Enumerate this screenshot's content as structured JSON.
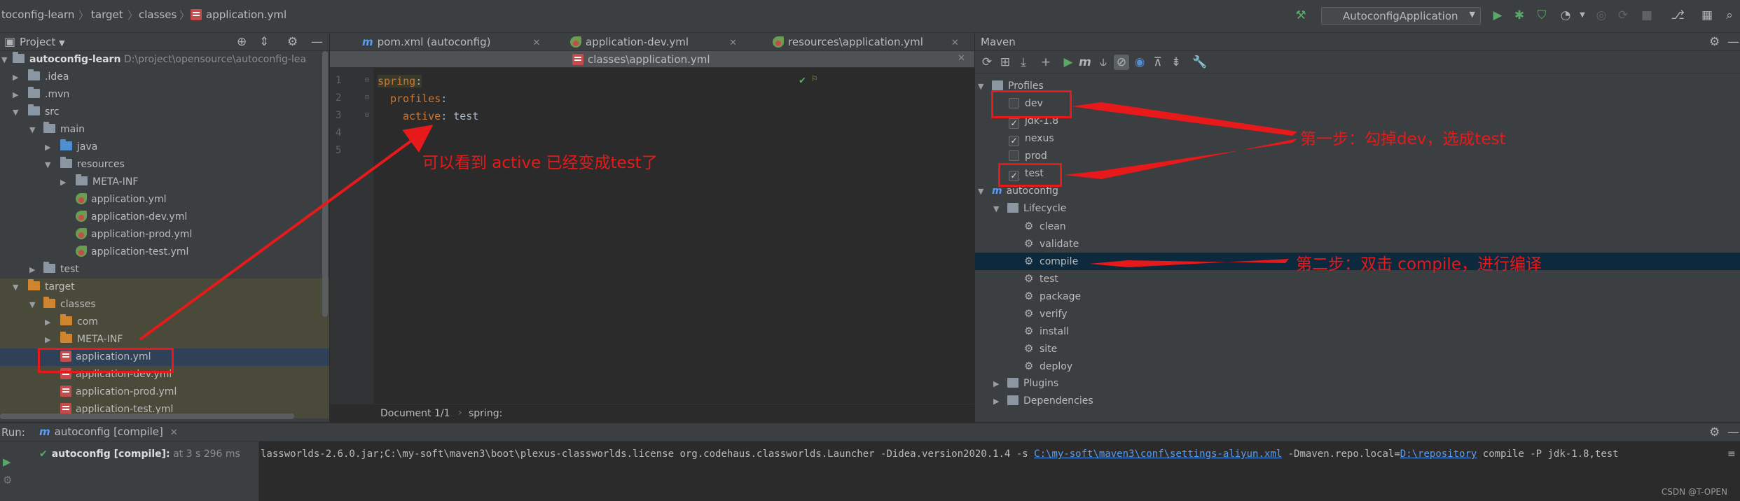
{
  "breadcrumb": [
    "toconfig-learn",
    "target",
    "classes",
    "application.yml"
  ],
  "toolbar": {
    "run_config": "AutoconfigApplication"
  },
  "project": {
    "title": "Project",
    "root_name": "autoconfig-learn",
    "root_path": "D:\\project\\opensource\\autoconfig-lea",
    "tree": [
      {
        "label": "autoconfig-learn",
        "depth": 0,
        "open": true
      },
      {
        "label": ".idea",
        "depth": 1,
        "open": false
      },
      {
        "label": ".mvn",
        "depth": 1,
        "open": false
      },
      {
        "label": "src",
        "depth": 1,
        "open": true
      },
      {
        "label": "main",
        "depth": 2,
        "open": true
      },
      {
        "label": "java",
        "depth": 3,
        "open": false
      },
      {
        "label": "resources",
        "depth": 3,
        "open": true
      },
      {
        "label": "META-INF",
        "depth": 4,
        "open": false
      },
      {
        "label": "application.yml",
        "depth": 5
      },
      {
        "label": "application-dev.yml",
        "depth": 5
      },
      {
        "label": "application-prod.yml",
        "depth": 5
      },
      {
        "label": "application-test.yml",
        "depth": 5
      },
      {
        "label": "test",
        "depth": 2,
        "open": false
      },
      {
        "label": "target",
        "depth": 1,
        "open": true
      },
      {
        "label": "classes",
        "depth": 2,
        "open": true
      },
      {
        "label": "com",
        "depth": 3,
        "open": false
      },
      {
        "label": "META-INF",
        "depth": 3,
        "open": false
      },
      {
        "label": "application.yml",
        "depth": 4,
        "selected": true
      },
      {
        "label": "application-dev.yml",
        "depth": 4
      },
      {
        "label": "application-prod.yml",
        "depth": 4
      },
      {
        "label": "application-test.yml",
        "depth": 4
      }
    ]
  },
  "editor": {
    "tabs": [
      {
        "label": "pom.xml (autoconfig)"
      },
      {
        "label": "application-dev.yml"
      },
      {
        "label": "resources\\application.yml"
      }
    ],
    "active_tab": "classes\\application.yml",
    "line_numbers": [
      "1",
      "2",
      "3",
      "4",
      "5"
    ],
    "lines": [
      {
        "key": "spring",
        "sep": ":",
        "value": ""
      },
      {
        "key": "profiles",
        "sep": ":",
        "value": ""
      },
      {
        "key": "active",
        "sep": ": ",
        "value": "test"
      }
    ],
    "status_doc": "Document 1/1",
    "status_path": "spring:"
  },
  "maven": {
    "title": "Maven",
    "profiles_label": "Profiles",
    "profiles": [
      {
        "name": "dev",
        "checked": false
      },
      {
        "name": "jdk-1.8",
        "checked": true
      },
      {
        "name": "nexus",
        "checked": true
      },
      {
        "name": "prod",
        "checked": false
      },
      {
        "name": "test",
        "checked": true
      }
    ],
    "project_label": "autoconfig",
    "lifecycle_label": "Lifecycle",
    "lifecycle": [
      "clean",
      "validate",
      "compile",
      "test",
      "package",
      "verify",
      "install",
      "site",
      "deploy"
    ],
    "selected_phase": "compile",
    "plugins_label": "Plugins",
    "dependencies_label": "Dependencies"
  },
  "run": {
    "label": "Run:",
    "tab": "autoconfig [compile]",
    "item_label": "autoconfig [compile]:",
    "item_time": "at 3 s 296 ms",
    "console_pre": "lassworlds-2.6.0.jar;C:\\my-soft\\maven3\\boot\\plexus-classworlds.license org.codehaus.classworlds.Launcher -Didea.version2020.1.4 -s ",
    "console_link1": "C:\\my-soft\\maven3\\conf\\settings-aliyun.xml",
    "console_mid": " -Dmaven.repo.local=",
    "console_link2": "D:\\repository",
    "console_post": " compile -P jdk-1.8,test"
  },
  "annotations": {
    "editor_note": "可以看到 active 已经变成test了",
    "step1": "第一步：勾掉dev，选成test",
    "step2": "第二步：双击 compile，进行编译",
    "watermark": "CSDN @T-OPEN"
  },
  "colors": {
    "annotation": "#e8191a",
    "keyword": "#cc7832",
    "link": "#589df6"
  }
}
